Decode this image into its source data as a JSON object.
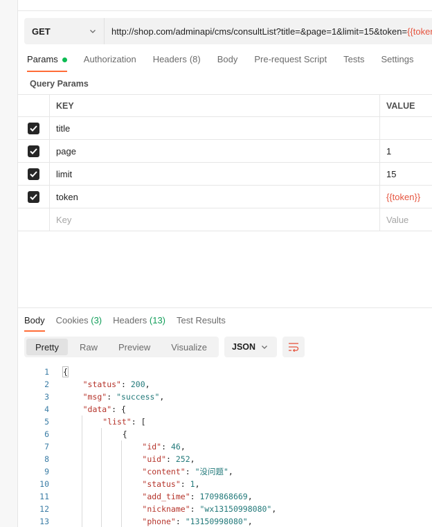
{
  "request": {
    "method": "GET",
    "url_prefix": "http://shop.com/adminapi/cms/consultList?title=&page=1&limit=15&token=",
    "url_var": "{{token"
  },
  "request_tabs": [
    {
      "label": "Params",
      "active": true,
      "dot": true
    },
    {
      "label": "Authorization"
    },
    {
      "label": "Headers",
      "count": "(8)"
    },
    {
      "label": "Body"
    },
    {
      "label": "Pre-request Script"
    },
    {
      "label": "Tests"
    },
    {
      "label": "Settings"
    }
  ],
  "query_params": {
    "title": "Query Params",
    "columns": {
      "key": "KEY",
      "value": "VALUE"
    },
    "rows": [
      {
        "key": "title",
        "value": "",
        "checked": true
      },
      {
        "key": "page",
        "value": "1",
        "checked": true
      },
      {
        "key": "limit",
        "value": "15",
        "checked": true
      },
      {
        "key": "token",
        "value": "{{token}}",
        "checked": true
      }
    ],
    "placeholder_key": "Key",
    "placeholder_value": "Value"
  },
  "response_tabs": [
    {
      "label": "Body",
      "active": true
    },
    {
      "label": "Cookies",
      "count": "(3)"
    },
    {
      "label": "Headers",
      "count": "(13)"
    },
    {
      "label": "Test Results"
    }
  ],
  "view_modes": [
    "Pretty",
    "Raw",
    "Preview",
    "Visualize"
  ],
  "active_view": "Pretty",
  "format": "JSON",
  "code_lines": [
    {
      "n": "1",
      "indent": 0,
      "parts": [
        [
          "p",
          "{"
        ]
      ]
    },
    {
      "n": "2",
      "indent": 1,
      "parts": [
        [
          "k",
          "\"status\""
        ],
        [
          "p",
          ": "
        ],
        [
          "n",
          "200"
        ],
        [
          "p",
          ","
        ]
      ]
    },
    {
      "n": "3",
      "indent": 1,
      "parts": [
        [
          "k",
          "\"msg\""
        ],
        [
          "p",
          ": "
        ],
        [
          "s",
          "\"success\""
        ],
        [
          "p",
          ","
        ]
      ]
    },
    {
      "n": "4",
      "indent": 1,
      "parts": [
        [
          "k",
          "\"data\""
        ],
        [
          "p",
          ": {"
        ]
      ]
    },
    {
      "n": "5",
      "indent": 2,
      "parts": [
        [
          "k",
          "\"list\""
        ],
        [
          "p",
          ": ["
        ]
      ]
    },
    {
      "n": "6",
      "indent": 3,
      "parts": [
        [
          "p",
          "{"
        ]
      ]
    },
    {
      "n": "7",
      "indent": 4,
      "parts": [
        [
          "k",
          "\"id\""
        ],
        [
          "p",
          ": "
        ],
        [
          "n",
          "46"
        ],
        [
          "p",
          ","
        ]
      ]
    },
    {
      "n": "8",
      "indent": 4,
      "parts": [
        [
          "k",
          "\"uid\""
        ],
        [
          "p",
          ": "
        ],
        [
          "n",
          "252"
        ],
        [
          "p",
          ","
        ]
      ]
    },
    {
      "n": "9",
      "indent": 4,
      "parts": [
        [
          "k",
          "\"content\""
        ],
        [
          "p",
          ": "
        ],
        [
          "s",
          "\"没问题\""
        ],
        [
          "p",
          ","
        ]
      ]
    },
    {
      "n": "10",
      "indent": 4,
      "parts": [
        [
          "k",
          "\"status\""
        ],
        [
          "p",
          ": "
        ],
        [
          "n",
          "1"
        ],
        [
          "p",
          ","
        ]
      ]
    },
    {
      "n": "11",
      "indent": 4,
      "parts": [
        [
          "k",
          "\"add_time\""
        ],
        [
          "p",
          ": "
        ],
        [
          "n",
          "1709868669"
        ],
        [
          "p",
          ","
        ]
      ]
    },
    {
      "n": "12",
      "indent": 4,
      "parts": [
        [
          "k",
          "\"nickname\""
        ],
        [
          "p",
          ": "
        ],
        [
          "s",
          "\"wx13150998080\""
        ],
        [
          "p",
          ","
        ]
      ]
    },
    {
      "n": "13",
      "indent": 4,
      "parts": [
        [
          "k",
          "\"phone\""
        ],
        [
          "p",
          ": "
        ],
        [
          "s",
          "\"13150998080\""
        ],
        [
          "p",
          ","
        ]
      ]
    }
  ]
}
